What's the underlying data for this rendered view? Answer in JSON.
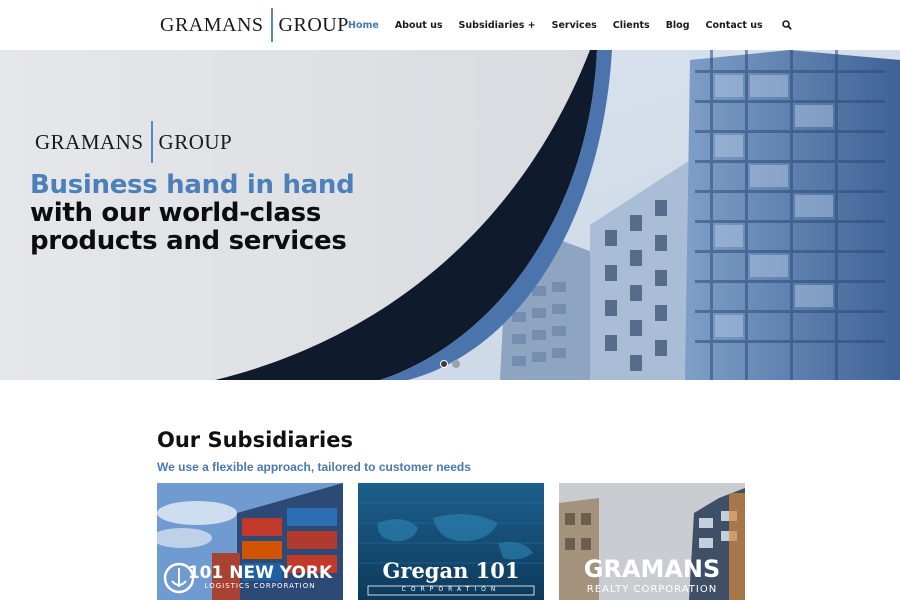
{
  "header": {
    "logo_left": "GRAMANS",
    "logo_right": "GROUP"
  },
  "nav": {
    "items": [
      {
        "label": "Home",
        "active": true
      },
      {
        "label": "About us",
        "active": false
      },
      {
        "label": "Subsidiaries +",
        "active": false
      },
      {
        "label": "Services",
        "active": false
      },
      {
        "label": "Clients",
        "active": false
      },
      {
        "label": "Blog",
        "active": false
      },
      {
        "label": "Contact us",
        "active": false
      }
    ],
    "search_icon": "search-icon"
  },
  "hero": {
    "logo_left": "GRAMANS",
    "logo_right": "GROUP",
    "line1": "Business hand in hand",
    "line2": "with our world-class",
    "line3": "products and services",
    "slide_count": 2,
    "active_slide": 1
  },
  "subsidiaries": {
    "title": "Our Subsidiaries",
    "subtitle": "We use a flexible approach, tailored to customer needs",
    "cards": [
      {
        "name": "101 NEW YORK",
        "sub": "LOGISTICS CORPORATION"
      },
      {
        "name": "Gregan 101",
        "sub": "CORPORATION"
      },
      {
        "name": "GRAMANS",
        "sub": "REALTY CORPORATION"
      }
    ]
  },
  "colors": {
    "accent": "#4a78b3",
    "dark_navy": "#0f1b2d",
    "hero_blue": "#4d7fb9"
  }
}
